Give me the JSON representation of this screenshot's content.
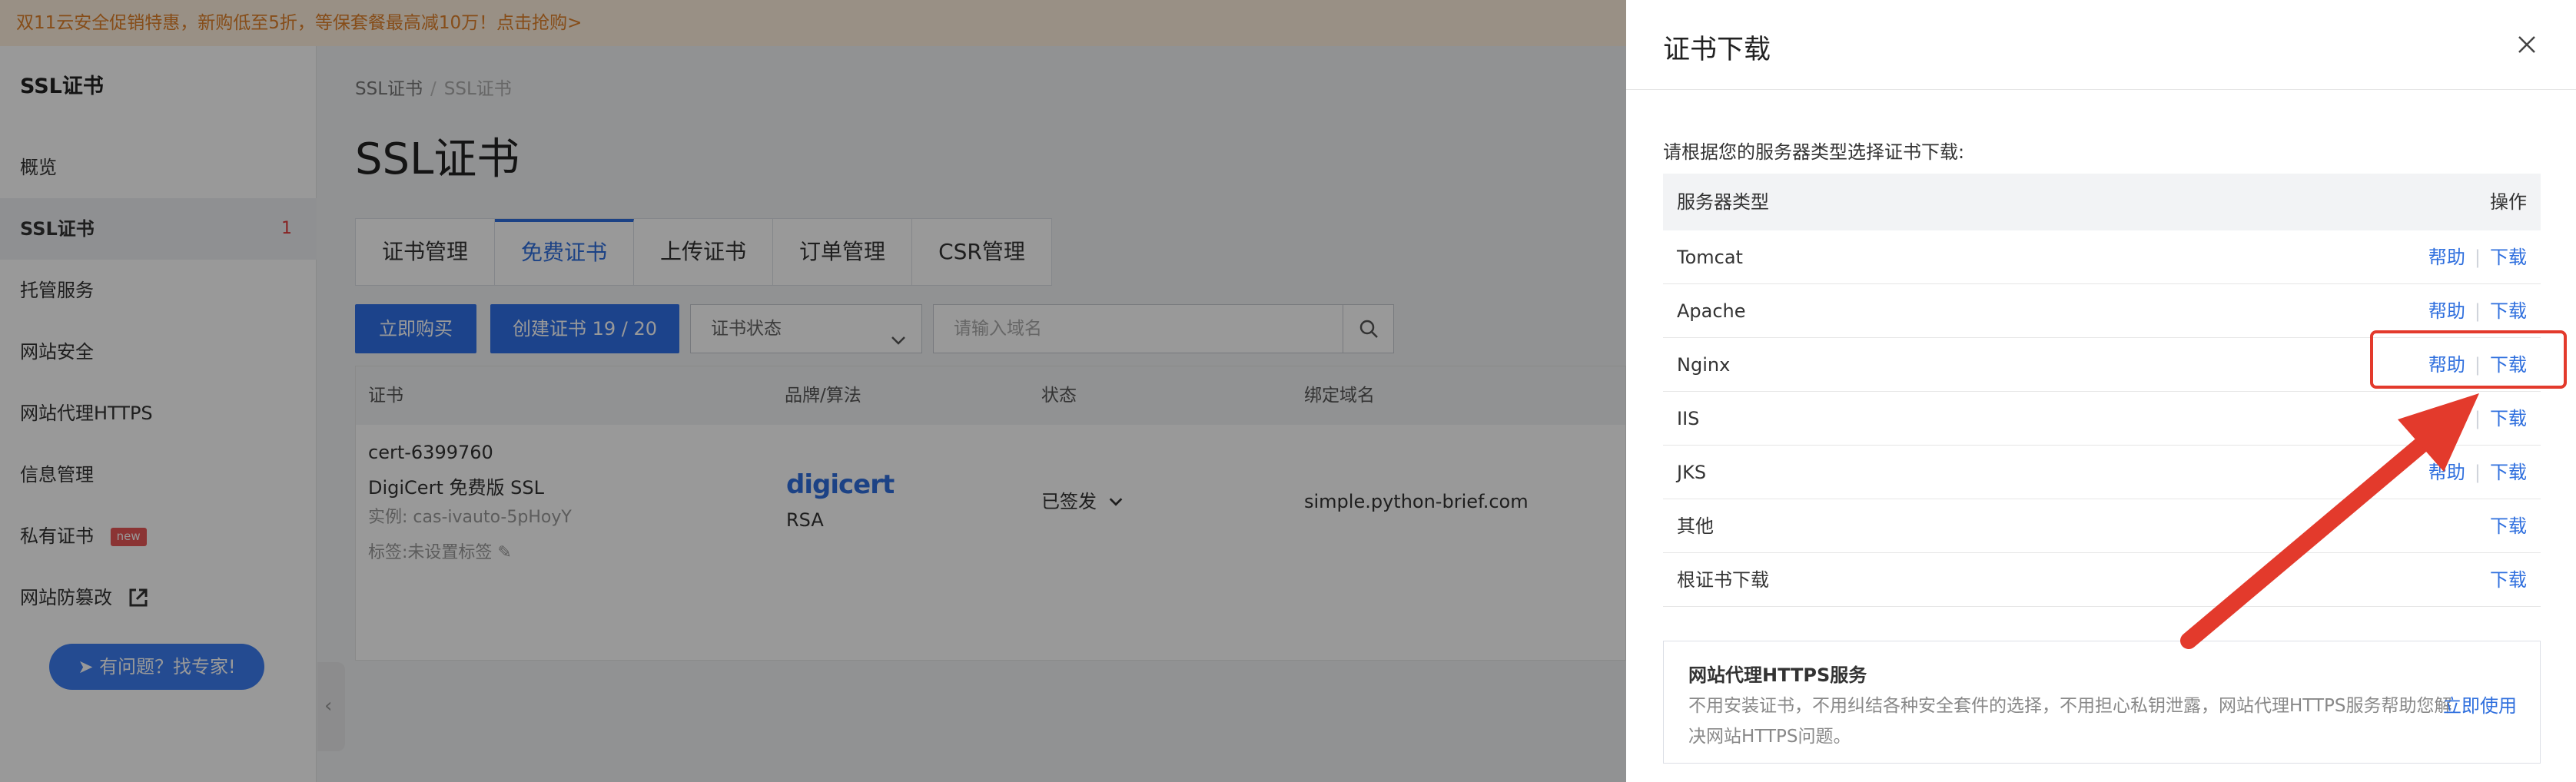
{
  "promo": {
    "text": "双11云安全促销特惠，新购低至5折，等保套餐最高减10万！点击抢购>"
  },
  "sidebar": {
    "title": "SSL证书",
    "items": [
      {
        "label": "概览"
      },
      {
        "label": "SSL证书",
        "count": "1",
        "active": true
      },
      {
        "label": "托管服务"
      },
      {
        "label": "网站安全"
      },
      {
        "label": "网站代理HTTPS"
      },
      {
        "label": "信息管理"
      },
      {
        "label": "私有证书",
        "badge": "new"
      },
      {
        "label": "网站防篡改"
      }
    ],
    "expert_button": "有问题？找专家!"
  },
  "breadcrumb": {
    "root": "SSL证书",
    "current": "SSL证书",
    "separator": "/"
  },
  "page_title": "SSL证书",
  "tabs": [
    "证书管理",
    "免费证书",
    "上传证书",
    "订单管理",
    "CSR管理"
  ],
  "active_tab": "免费证书",
  "toolbar": {
    "buy_label": "立即购买",
    "create_label": "创建证书 19 / 20",
    "status_select": "证书状态",
    "search_placeholder": "请输入域名"
  },
  "cert_table": {
    "headers": [
      "证书",
      "品牌/算法",
      "状态",
      "绑定域名"
    ],
    "row": {
      "cert_name": "cert-6399760",
      "cert_type": "DigiCert 免费版 SSL",
      "instance": "实例: cas-ivauto-5pHoyY",
      "tag": "标签:未设置标签",
      "brand": "digicert",
      "algorithm": "RSA",
      "status": "已签发",
      "domain": "simple.python-brief.com"
    }
  },
  "drawer": {
    "title": "证书下载",
    "instruction": "请根据您的服务器类型选择证书下载:",
    "headers": {
      "server_type": "服务器类型",
      "action": "操作"
    },
    "help_label": "帮助",
    "download_label": "下载",
    "rows": [
      {
        "name": "Tomcat",
        "help": true
      },
      {
        "name": "Apache",
        "help": true
      },
      {
        "name": "Nginx",
        "help": true,
        "highlighted": true
      },
      {
        "name": "IIS",
        "help": true
      },
      {
        "name": "JKS",
        "help": true
      },
      {
        "name": "其他",
        "help": false
      },
      {
        "name": "根证书下载",
        "help": false
      }
    ],
    "https_card": {
      "title": "网站代理HTTPS服务",
      "description": "不用安装证书，不用纠结各种安全套件的选择，不用担心私钥泄露，网站代理HTTPS服务帮助您解决网站HTTPS问题。",
      "link": "立即使用"
    }
  },
  "colors": {
    "accent": "#2f6fde",
    "annotation": "#e33a2c",
    "promo": "#e0812a"
  }
}
